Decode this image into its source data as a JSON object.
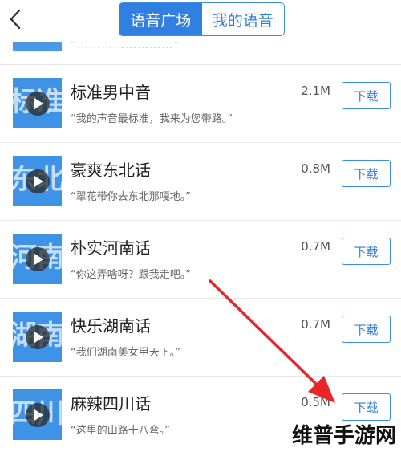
{
  "header": {
    "back_icon": "chevron-left-icon",
    "tabs": [
      {
        "label": "语音广场",
        "active": true
      },
      {
        "label": "我的语音",
        "active": false
      }
    ]
  },
  "list": {
    "partial_quote": "“……………………”",
    "items": [
      {
        "name": "标准男中音",
        "quote": "“我的声音最标准，我来为您带路。”",
        "size": "2.1M",
        "download_label": "下载",
        "thumb_text": "标准"
      },
      {
        "name": "豪爽东北话",
        "quote": "“翠花带你去东北那嘎地。”",
        "size": "0.8M",
        "download_label": "下载",
        "thumb_text": "东北"
      },
      {
        "name": "朴实河南话",
        "quote": "“你这弄啥呀？跟我走吧。”",
        "size": "0.7M",
        "download_label": "下载",
        "thumb_text": "河南"
      },
      {
        "name": "快乐湖南话",
        "quote": "“我们湖南美女甲天下。”",
        "size": "0.7M",
        "download_label": "下载",
        "thumb_text": "湖南"
      },
      {
        "name": "麻辣四川话",
        "quote": "“这里的山路十八弯。”",
        "size": "0.5M",
        "download_label": "下载",
        "thumb_text": "四川"
      }
    ]
  },
  "annotation": {
    "arrow_color": "#e8262a"
  },
  "watermark": "维普手游网",
  "colors": {
    "accent": "#2f80e0",
    "thumb": "#3f93e6"
  }
}
